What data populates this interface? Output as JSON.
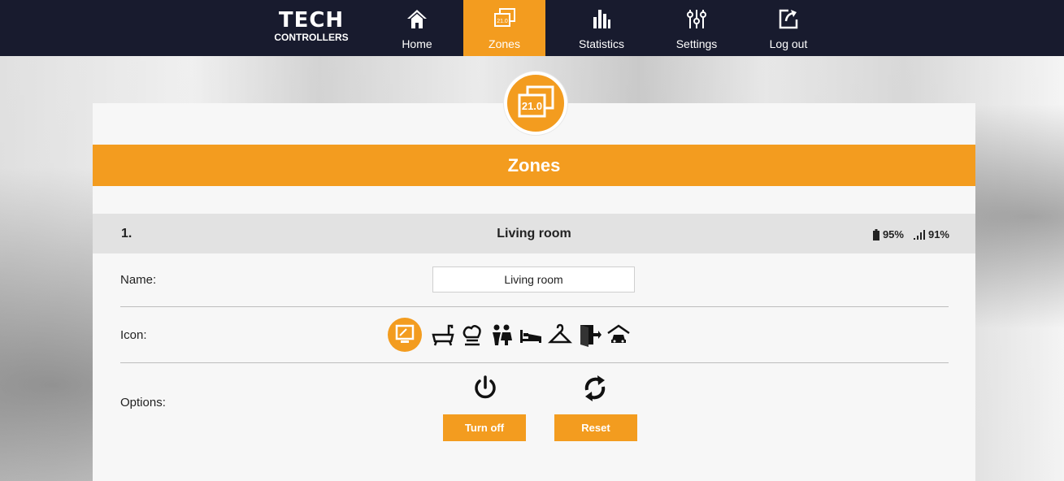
{
  "brand": {
    "logo_mark": "TECH",
    "logo_sub": "CONTROLLERS"
  },
  "nav": [
    {
      "label": "Home",
      "icon": "home-icon",
      "active": false
    },
    {
      "label": "Zones",
      "icon": "zones-icon",
      "active": true
    },
    {
      "label": "Statistics",
      "icon": "statistics-icon",
      "active": false
    },
    {
      "label": "Settings",
      "icon": "settings-icon",
      "active": false
    },
    {
      "label": "Log out",
      "icon": "logout-icon",
      "active": false
    }
  ],
  "zones_icon_value": "21.0",
  "page": {
    "title": "Zones"
  },
  "zone": {
    "number": "1.",
    "name": "Living room",
    "battery": "95%",
    "signal": "91%"
  },
  "form": {
    "name_label": "Name:",
    "name_value": "Living room",
    "icon_label": "Icon:",
    "icons": [
      "monitor-icon",
      "bathtub-icon",
      "chef-hat-icon",
      "children-icon",
      "bed-icon",
      "hanger-icon",
      "door-exit-icon",
      "garage-car-icon"
    ],
    "selected_icon": "monitor-icon",
    "options_label": "Options:",
    "turn_off_label": "Turn off",
    "reset_label": "Reset"
  },
  "colors": {
    "accent": "#f39c1f",
    "nav_bg": "#181b2e",
    "card_bg": "#f7f7f7",
    "header_bg": "#e2e2e2"
  }
}
